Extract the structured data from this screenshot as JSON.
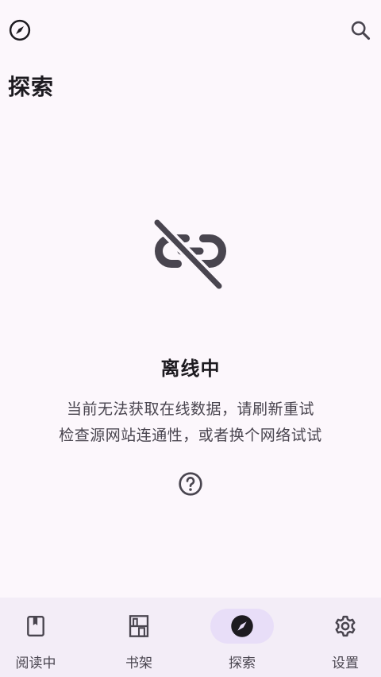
{
  "header": {
    "title": "探索",
    "left_icon": "compass-icon",
    "right_icon": "search-icon"
  },
  "offline": {
    "icon": "link-off-icon",
    "title": "离线中",
    "line1": "当前无法获取在线数据，请刷新重试",
    "line2": "检查源网站连通性，或者换个网络试试",
    "help_icon": "help-circle-icon"
  },
  "bottom_nav": {
    "items": [
      {
        "label": "阅读中",
        "icon": "book-icon",
        "active": false
      },
      {
        "label": "书架",
        "icon": "bookshelf-icon",
        "active": false
      },
      {
        "label": "探索",
        "icon": "compass-icon",
        "active": true
      },
      {
        "label": "设置",
        "icon": "gear-icon",
        "active": false
      }
    ]
  },
  "colors": {
    "background": "#fcf7fc",
    "nav_background": "#f3edf7",
    "active_indicator": "#e8def8",
    "icon": "#49454f",
    "text": "#1d1b20"
  }
}
